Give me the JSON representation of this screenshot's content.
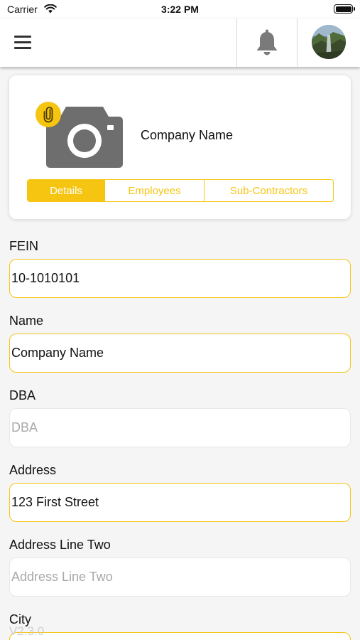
{
  "status_bar": {
    "carrier": "Carrier",
    "time": "3:22 PM"
  },
  "nav": {
    "menu_icon": "hamburger-menu-icon",
    "bell_icon": "bell-icon",
    "avatar_icon": "profile-avatar"
  },
  "company": {
    "name": "Company Name",
    "camera_icon": "camera-icon",
    "attach_icon": "paperclip-icon"
  },
  "tabs": [
    {
      "label": "Details",
      "active": true
    },
    {
      "label": "Employees",
      "active": false
    },
    {
      "label": "Sub-Contractors",
      "active": false
    }
  ],
  "form": {
    "fein": {
      "label": "FEIN",
      "value": "10-1010101",
      "placeholder": ""
    },
    "name": {
      "label": "Name",
      "value": "Company Name",
      "placeholder": ""
    },
    "dba": {
      "label": "DBA",
      "value": "",
      "placeholder": "DBA"
    },
    "address": {
      "label": "Address",
      "value": "123 First Street",
      "placeholder": ""
    },
    "address2": {
      "label": "Address Line Two",
      "value": "",
      "placeholder": "Address Line Two"
    },
    "city": {
      "label": "City",
      "value": "",
      "placeholder": ""
    }
  },
  "footer": {
    "version": "V2.3.0"
  },
  "colors": {
    "accent": "#f6c512",
    "icon_gray": "#777777",
    "background": "#f5f5f5"
  }
}
